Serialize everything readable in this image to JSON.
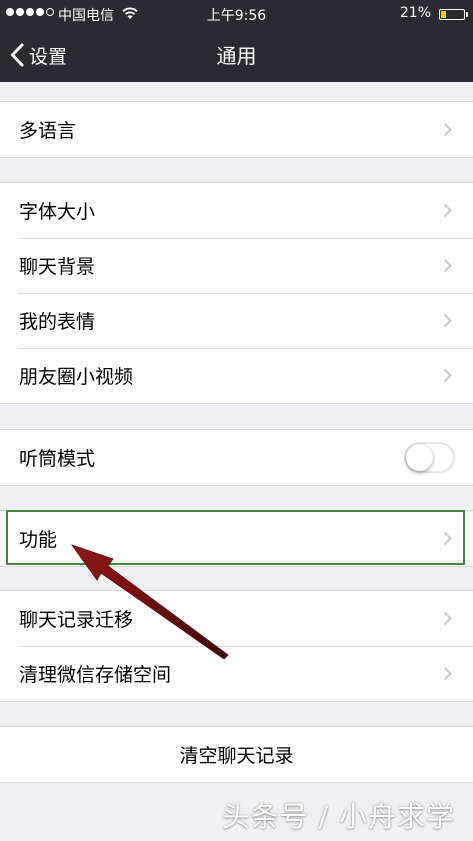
{
  "status_bar": {
    "carrier": "中国电信",
    "time": "上午9:56",
    "battery_percent": "21%",
    "battery_level": 0.21,
    "signal_bars": 4,
    "icons": [
      "signal-dots-icon",
      "wifi-icon",
      "battery-icon"
    ]
  },
  "nav": {
    "back_label": "设置",
    "title": "通用"
  },
  "groups": [
    {
      "items": [
        {
          "label": "多语言"
        }
      ]
    },
    {
      "items": [
        {
          "label": "字体大小"
        },
        {
          "label": "聊天背景"
        },
        {
          "label": "我的表情"
        },
        {
          "label": "朋友圈小视频"
        }
      ]
    },
    {
      "items": [
        {
          "label": "听筒模式",
          "toggle": false
        }
      ]
    },
    {
      "items": [
        {
          "label": "功能"
        }
      ]
    },
    {
      "items": [
        {
          "label": "聊天记录迁移"
        },
        {
          "label": "清理微信存储空间"
        }
      ]
    },
    {
      "items": [
        {
          "label": "清空聊天记录"
        }
      ]
    }
  ],
  "annotation": {
    "highlight_color": "#3d8b3a",
    "arrow_color": "#7a0f0f"
  },
  "watermark": "头条号 / 小舟求学",
  "colors": {
    "nav_bg": "#2b2a30",
    "page_bg": "#efeff4",
    "chevron": "#c7c7cc"
  }
}
